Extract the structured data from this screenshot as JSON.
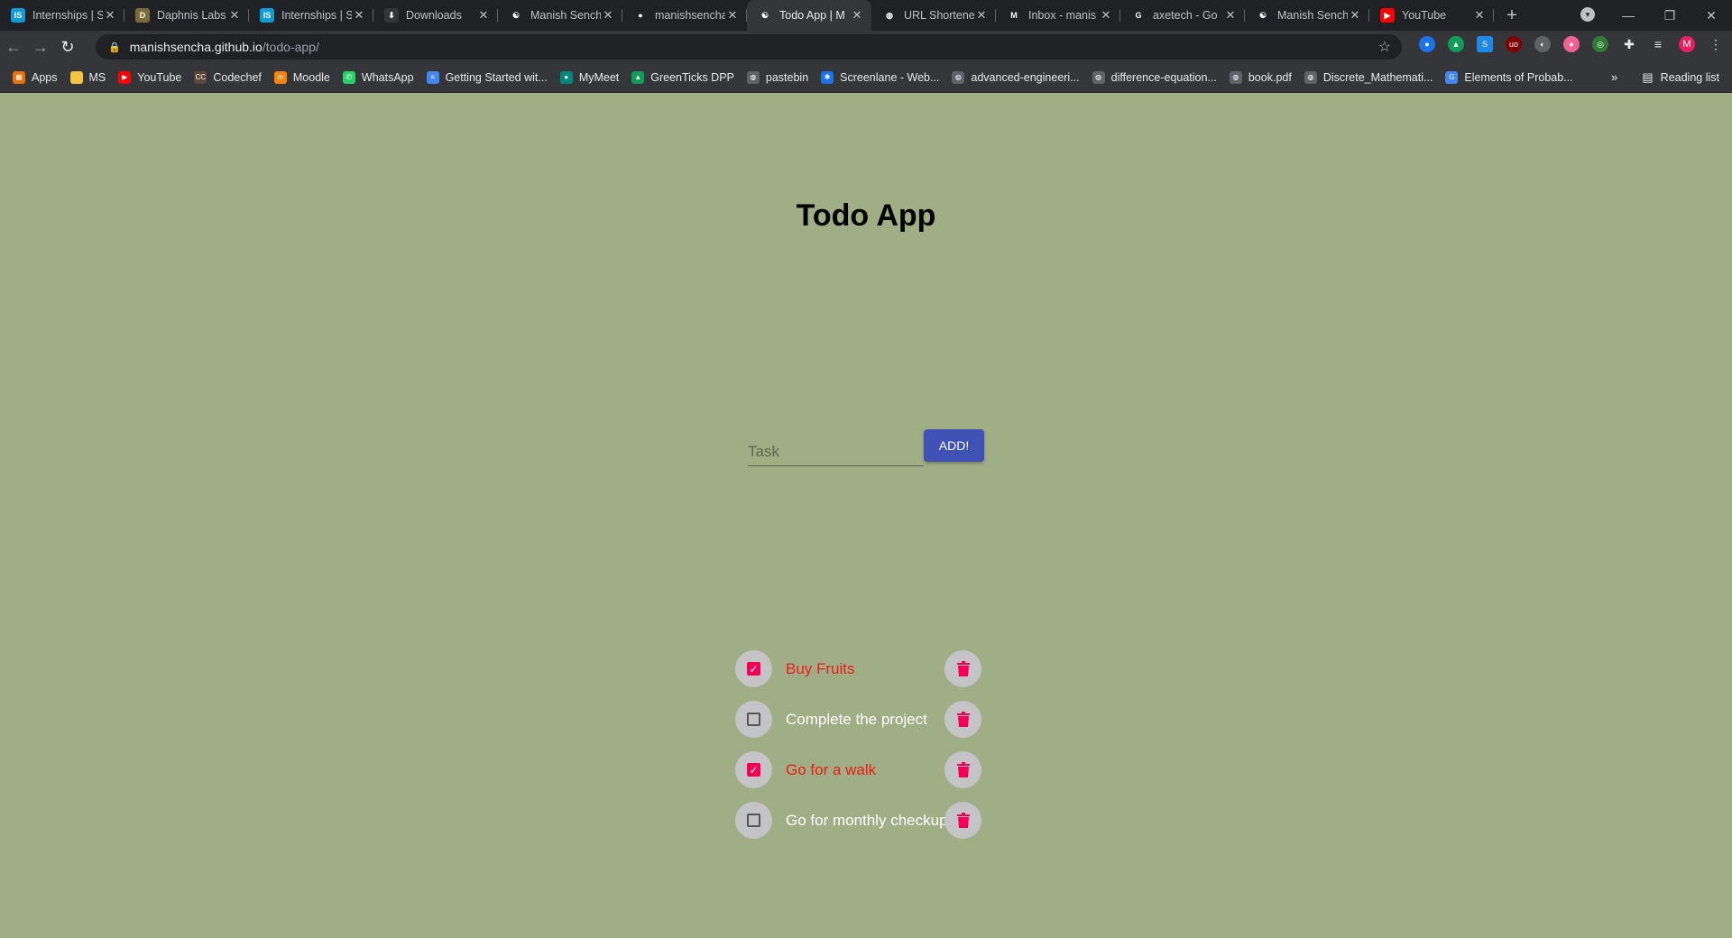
{
  "browser": {
    "tabs": [
      {
        "title": "Internships | S",
        "icon": "internshala-icon",
        "color": "#0e9bd8",
        "glyph": "IS"
      },
      {
        "title": "Daphnis Labs",
        "icon": "daphnis-icon",
        "color": "#7a6b3a",
        "glyph": "D"
      },
      {
        "title": "Internships | S",
        "icon": "internshala-icon",
        "color": "#0e9bd8",
        "glyph": "IS"
      },
      {
        "title": "Downloads",
        "icon": "download-icon",
        "color": "#35363a",
        "glyph": "⬇"
      },
      {
        "title": "Manish Sench",
        "icon": "yinyang-icon",
        "color": "#202124",
        "glyph": "☯"
      },
      {
        "title": "manishsencha",
        "icon": "github-icon",
        "color": "#202124",
        "glyph": "●"
      },
      {
        "title": "Todo App | M",
        "icon": "yinyang-icon",
        "color": "#35363a",
        "glyph": "☯",
        "active": true
      },
      {
        "title": "URL Shortene",
        "icon": "globe-icon",
        "color": "#202124",
        "glyph": "◍"
      },
      {
        "title": "Inbox - manis",
        "icon": "gmail-icon",
        "color": "#202124",
        "glyph": "M"
      },
      {
        "title": "axetech - Go",
        "icon": "google-icon",
        "color": "#202124",
        "glyph": "G"
      },
      {
        "title": "Manish Sench",
        "icon": "yinyang-icon",
        "color": "#202124",
        "glyph": "☯"
      },
      {
        "title": "YouTube",
        "icon": "youtube-icon",
        "color": "#ff0000",
        "glyph": "▶"
      }
    ],
    "url_host": "manishsencha.github.io",
    "url_path": "/todo-app/",
    "bookmarks": [
      {
        "label": "Apps",
        "icon": "apps-grid-icon",
        "color": "#e8710a",
        "glyph": "▦"
      },
      {
        "label": "MS",
        "icon": "folder-icon",
        "color": "#f4c542",
        "glyph": ""
      },
      {
        "label": "YouTube",
        "icon": "youtube-icon",
        "color": "#ff0000",
        "glyph": "▶"
      },
      {
        "label": "Codechef",
        "icon": "codechef-icon",
        "color": "#5b4638",
        "glyph": "CC"
      },
      {
        "label": "Moodle",
        "icon": "moodle-icon",
        "color": "#f98012",
        "glyph": "m"
      },
      {
        "label": "WhatsApp",
        "icon": "whatsapp-icon",
        "color": "#25d366",
        "glyph": "✆"
      },
      {
        "label": "Getting Started wit...",
        "icon": "docs-icon",
        "color": "#4285f4",
        "glyph": "≡"
      },
      {
        "label": "MyMeet",
        "icon": "meet-icon",
        "color": "#00897b",
        "glyph": "●"
      },
      {
        "label": "GreenTicks DPP",
        "icon": "drive-icon",
        "color": "#0f9d58",
        "glyph": "▲"
      },
      {
        "label": "pastebin",
        "icon": "globe-icon",
        "color": "#5f6368",
        "glyph": "◍"
      },
      {
        "label": "Screenlane - Web...",
        "icon": "screenlane-icon",
        "color": "#1a73e8",
        "glyph": "✱"
      },
      {
        "label": "advanced-engineeri...",
        "icon": "globe-icon",
        "color": "#5f6368",
        "glyph": "◍"
      },
      {
        "label": "difference-equation...",
        "icon": "globe-icon",
        "color": "#5f6368",
        "glyph": "◍"
      },
      {
        "label": "book.pdf",
        "icon": "globe-icon",
        "color": "#5f6368",
        "glyph": "◍"
      },
      {
        "label": "Discrete_Mathemati...",
        "icon": "globe-icon",
        "color": "#5f6368",
        "glyph": "◍"
      },
      {
        "label": "Elements of Probab...",
        "icon": "google-icon",
        "color": "#4285f4",
        "glyph": "G"
      }
    ],
    "more_label": "»",
    "reading_list": "Reading list",
    "profile_initial": "M"
  },
  "app": {
    "title": "Todo App",
    "input_placeholder": "Task",
    "input_value": "",
    "add_label": "ADD!",
    "accent_color": "#3f51b5",
    "checkbox_color": "#f50057",
    "done_text_color": "#ee1b1b",
    "todos": [
      {
        "text": "Buy Fruits",
        "done": true
      },
      {
        "text": "Complete the project",
        "done": false
      },
      {
        "text": "Go for a walk",
        "done": true
      },
      {
        "text": "Go for monthly checkup.",
        "done": false
      }
    ]
  }
}
